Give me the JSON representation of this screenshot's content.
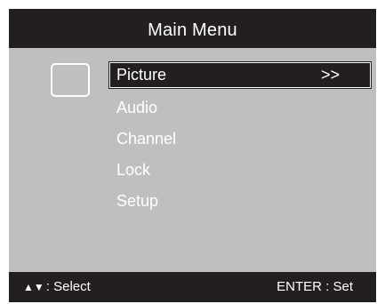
{
  "title": "Main Menu",
  "menu": {
    "items": [
      {
        "label": "Picture",
        "arrow": ">>"
      },
      {
        "label": "Audio"
      },
      {
        "label": "Channel"
      },
      {
        "label": "Lock"
      },
      {
        "label": "Setup"
      }
    ]
  },
  "footer": {
    "nav_icons": "▲▼",
    "left_label": ": Select",
    "right_label": "ENTER : Set"
  },
  "colors": {
    "panel": "#bfbfbf",
    "bars": "#231f20",
    "text": "#ffffff"
  },
  "icons": {
    "menu_category": "picture-frame-icon",
    "navigation": "up-down-arrows-icon"
  }
}
